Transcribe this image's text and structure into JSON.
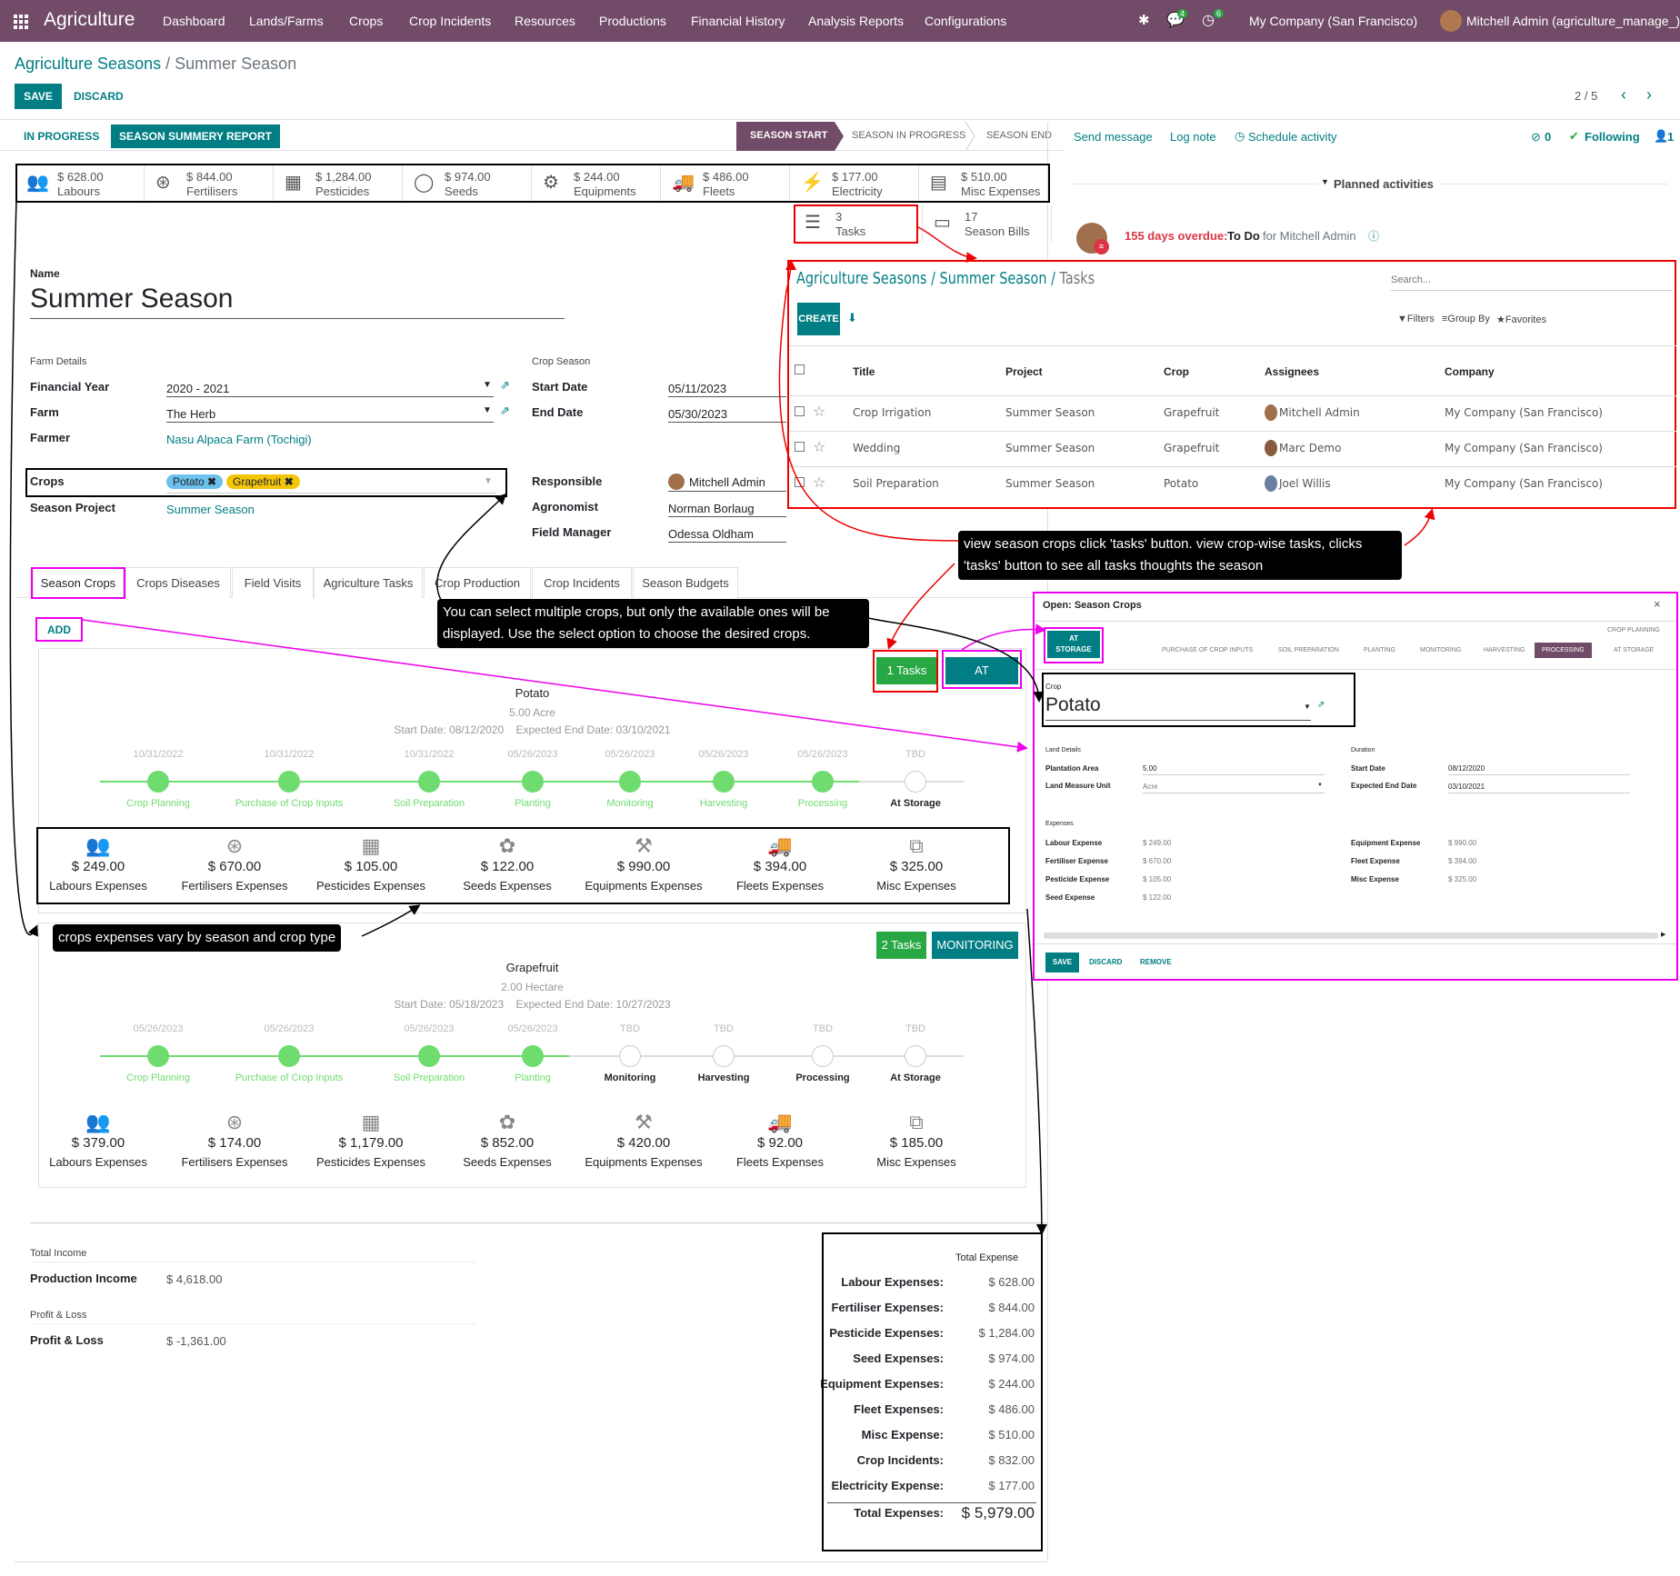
{
  "nav": {
    "app_name": "Agriculture",
    "menu": [
      "Dashboard",
      "Lands/Farms",
      "Crops",
      "Crop Incidents",
      "Resources",
      "Productions",
      "Financial History",
      "Analysis Reports",
      "Configurations"
    ],
    "chat_badge": "4",
    "activity_badge": "6",
    "company": "My Company (San Francisco)",
    "user": "Mitchell Admin (agriculture_manage_)"
  },
  "breadcrumb": {
    "parent": "Agriculture Seasons",
    "sep": "/",
    "current": "Summer Season"
  },
  "control": {
    "save": "SAVE",
    "discard": "DISCARD",
    "pager": "2 / 5"
  },
  "statusbar": {
    "btn_in_progress": "IN PROGRESS",
    "btn_report": "SEASON SUMMERY REPORT",
    "stages": [
      "SEASON START",
      "SEASON IN PROGRESS",
      "SEASON END"
    ],
    "active_stage": "SEASON START"
  },
  "smart_buttons": [
    {
      "value": "$ 628.00",
      "label": "Labours",
      "icon": "users-icon"
    },
    {
      "value": "$ 844.00",
      "label": "Fertilisers",
      "icon": "lifebuoy-icon"
    },
    {
      "value": "$ 1,284.00",
      "label": "Pesticides",
      "icon": "cubes-icon"
    },
    {
      "value": "$ 974.00",
      "label": "Seeds",
      "icon": "leaf-icon"
    },
    {
      "value": "$ 244.00",
      "label": "Equipments",
      "icon": "cogs-icon"
    },
    {
      "value": "$ 486.00",
      "label": "Fleets",
      "icon": "truck-icon"
    },
    {
      "value": "$ 177.00",
      "label": "Electricity",
      "icon": "bolt-icon"
    },
    {
      "value": "$ 510.00",
      "label": "Misc Expenses",
      "icon": "file-icon"
    },
    {
      "value": "3",
      "label": "Tasks",
      "icon": "tasks-icon"
    },
    {
      "value": "17",
      "label": "Season Bills",
      "icon": "money-icon"
    }
  ],
  "form": {
    "name_label": "Name",
    "name": "Summer Season",
    "farm_details_title": "Farm Details",
    "crop_season_title": "Crop Season",
    "financial_year_label": "Financial Year",
    "financial_year": "2020 - 2021",
    "farm_label": "Farm",
    "farm": "The Herb",
    "farmer_label": "Farmer",
    "farmer": "Nasu Alpaca Farm (Tochigi)",
    "start_date_label": "Start Date",
    "start_date": "05/11/2023",
    "end_date_label": "End Date",
    "end_date": "05/30/2023",
    "crops_label": "Crops",
    "crop_tags": [
      "Potato",
      "Grapefruit"
    ],
    "season_project_label": "Season Project",
    "season_project": "Summer Season",
    "responsible_label": "Responsible",
    "responsible": "Mitchell Admin",
    "agronomist_label": "Agronomist",
    "agronomist": "Norman Borlaug",
    "field_manager_label": "Field Manager",
    "field_manager": "Odessa Oldham"
  },
  "tabs": [
    "Season Crops",
    "Crops Diseases",
    "Field Visits",
    "Agriculture Tasks",
    "Crop Production",
    "Crop Incidents",
    "Season Budgets"
  ],
  "add_label": "ADD",
  "crops": [
    {
      "name": "Potato",
      "area": "5.00 Acre",
      "dates": "Start Date: 08/12/2020    Expected End Date: 03/10/2021",
      "tasks": "1 Tasks",
      "stage": "AT STORAGE",
      "steps": [
        {
          "label": "Crop Planning",
          "date": "10/31/2022",
          "done": true
        },
        {
          "label": "Purchase of Crop Inputs",
          "date": "10/31/2022",
          "done": true
        },
        {
          "label": "Soil Preparation",
          "date": "10/31/2022",
          "done": true
        },
        {
          "label": "Planting",
          "date": "05/26/2023",
          "done": true
        },
        {
          "label": "Monitoring",
          "date": "05/26/2023",
          "done": true
        },
        {
          "label": "Harvesting",
          "date": "05/26/2023",
          "done": true
        },
        {
          "label": "Processing",
          "date": "05/26/2023",
          "done": true
        },
        {
          "label": "At Storage",
          "date": "TBD",
          "done": false
        }
      ],
      "expenses": [
        {
          "value": "$ 249.00",
          "label": "Labours Expenses"
        },
        {
          "value": "$ 670.00",
          "label": "Fertilisers Expenses"
        },
        {
          "value": "$ 105.00",
          "label": "Pesticides Expenses"
        },
        {
          "value": "$ 122.00",
          "label": "Seeds Expenses"
        },
        {
          "value": "$ 990.00",
          "label": "Equipments Expenses"
        },
        {
          "value": "$ 394.00",
          "label": "Fleets Expenses"
        },
        {
          "value": "$ 325.00",
          "label": "Misc Expenses"
        }
      ]
    },
    {
      "name": "Grapefruit",
      "area": "2.00  Hectare",
      "dates": "Start Date: 05/18/2023    Expected End Date: 10/27/2023",
      "tasks": "2 Tasks",
      "stage": "MONITORING",
      "steps": [
        {
          "label": "Crop Planning",
          "date": "05/26/2023",
          "done": true
        },
        {
          "label": "Purchase of Crop Inputs",
          "date": "05/26/2023",
          "done": true
        },
        {
          "label": "Soil Preparation",
          "date": "05/26/2023",
          "done": true
        },
        {
          "label": "Planting",
          "date": "05/26/2023",
          "done": true
        },
        {
          "label": "Monitoring",
          "date": "TBD",
          "done": false
        },
        {
          "label": "Harvesting",
          "date": "TBD",
          "done": false
        },
        {
          "label": "Processing",
          "date": "TBD",
          "done": false
        },
        {
          "label": "At Storage",
          "date": "TBD",
          "done": false
        }
      ],
      "expenses": [
        {
          "value": "$ 379.00",
          "label": "Labours Expenses"
        },
        {
          "value": "$ 174.00",
          "label": "Fertilisers Expenses"
        },
        {
          "value": "$ 1,179.00",
          "label": "Pesticides Expenses"
        },
        {
          "value": "$ 852.00",
          "label": "Seeds Expenses"
        },
        {
          "value": "$ 420.00",
          "label": "Equipments Expenses"
        },
        {
          "value": "$ 92.00",
          "label": "Fleets Expenses"
        },
        {
          "value": "$ 185.00",
          "label": "Misc Expenses"
        }
      ]
    }
  ],
  "income": {
    "total_income_title": "Total Income",
    "production_income_label": "Production Income",
    "production_income": "$ 4,618.00",
    "pl_title": "Profit & Loss",
    "pl_label": "Profit & Loss",
    "pl_value": "$ -1,361.00"
  },
  "total_expense": {
    "title": "Total Expense",
    "rows": [
      {
        "label": "Labour Expenses:",
        "value": "$ 628.00"
      },
      {
        "label": "Fertiliser Expenses:",
        "value": "$ 844.00"
      },
      {
        "label": "Pesticide Expenses:",
        "value": "$ 1,284.00"
      },
      {
        "label": "Seed Expenses:",
        "value": "$ 974.00"
      },
      {
        "label": "Equipment Expenses:",
        "value": "$ 244.00"
      },
      {
        "label": "Fleet Expenses:",
        "value": "$ 486.00"
      },
      {
        "label": "Misc Expense:",
        "value": "$ 510.00"
      },
      {
        "label": "Crop Incidents:",
        "value": "$ 832.00"
      },
      {
        "label": "Electricity Expense:",
        "value": "$ 177.00"
      }
    ],
    "total_label": "Total Expenses:",
    "total_value": "$ 5,979.00"
  },
  "chatter": {
    "send_message": "Send message",
    "log_note": "Log note",
    "schedule": "Schedule activity",
    "attachments": "0",
    "following": "Following",
    "followers": "1",
    "planned": "Planned activities",
    "overdue": "155 days overdue:",
    "todo": "To Do",
    "for": "for Mitchell Admin"
  },
  "tasks_popup": {
    "breadcrumb": [
      "Agriculture Seasons",
      "Summer Season",
      "Tasks"
    ],
    "search_placeholder": "Search...",
    "create": "CREATE",
    "filters": "Filters",
    "group_by": "Group By",
    "favorites": "Favorites",
    "columns": [
      "Title",
      "Project",
      "Crop",
      "Assignees",
      "Company"
    ],
    "rows": [
      {
        "title": "Crop Irrigation",
        "project": "Summer Season",
        "crop": "Grapefruit",
        "assignee": "Mitchell Admin",
        "company": "My Company (San Francisco)"
      },
      {
        "title": "Wedding",
        "project": "Summer Season",
        "crop": "Grapefruit",
        "assignee": "Marc Demo",
        "company": "My Company (San Francisco)"
      },
      {
        "title": "Soil Preparation",
        "project": "Summer Season",
        "crop": "Potato",
        "assignee": "Joel Willis",
        "company": "My Company (San Francisco)"
      }
    ]
  },
  "season_crop_dialog": {
    "title": "Open: Season Crops",
    "at_storage": [
      "AT",
      "STORAGE"
    ],
    "stages": [
      "CROP PLANNING",
      "PURCHASE OF CROP INPUTS",
      "SOIL PREPARATION",
      "PLANTING",
      "MONITORING",
      "HARVESTING",
      "PROCESSING",
      "AT STORAGE"
    ],
    "active_stage": "PROCESSING",
    "crop_label": "Crop",
    "crop": "Potato",
    "land_details": "Land Details",
    "duration": "Duration",
    "plantation_area_label": "Plantation Area",
    "plantation_area": "5.00",
    "measure_label": "Land Measure Unit",
    "measure": "Acre",
    "start_label": "Start Date",
    "start": "08/12/2020",
    "end_label": "Expected End Date",
    "end": "03/10/2021",
    "expenses_title": "Expenses",
    "left_expenses": [
      {
        "label": "Labour Expense",
        "value": "$ 249.00"
      },
      {
        "label": "Fertiliser Expense",
        "value": "$ 670.00"
      },
      {
        "label": "Pesticide Expense",
        "value": "$ 105.00"
      },
      {
        "label": "Seed Expense",
        "value": "$ 122.00"
      }
    ],
    "right_expenses": [
      {
        "label": "Equipment Expense",
        "value": "$ 990.00"
      },
      {
        "label": "Fleet Expense",
        "value": "$ 394.00"
      },
      {
        "label": "Misc Expense",
        "value": "$ 325.00"
      }
    ],
    "save": "SAVE",
    "discard": "DISCARD",
    "remove": "REMOVE"
  },
  "annotations": {
    "tasks_note": "view season crops click 'tasks' button. view crop-wise tasks, clicks 'tasks' button to see all tasks thoughts the season",
    "crops_note": "You can select multiple crops, but only the available ones will be displayed. Use the select option to choose the desired crops.",
    "expense_note": "crops expenses vary by season and crop type"
  },
  "colors": {
    "brand": "#714B67",
    "teal": "#017e84",
    "green": "#28a745",
    "step_green": "#6fdc6f",
    "red": "#e00000",
    "magenta": "#e000e0"
  }
}
